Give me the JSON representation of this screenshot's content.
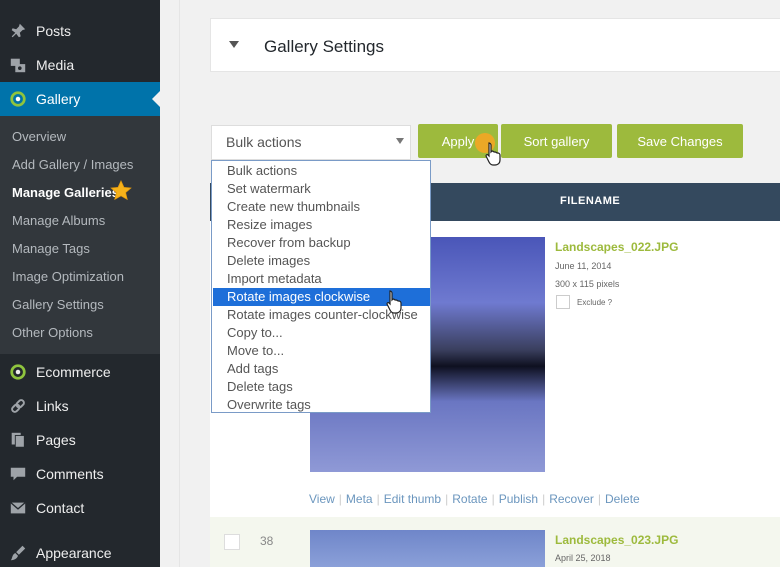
{
  "sidebar": {
    "items": [
      {
        "label": "Posts",
        "icon": "pushpin-icon"
      },
      {
        "label": "Media",
        "icon": "media-icon"
      },
      {
        "label": "Gallery",
        "icon": "gallery-icon"
      },
      {
        "label": "Ecommerce",
        "icon": "ecommerce-icon"
      },
      {
        "label": "Links",
        "icon": "link-icon"
      },
      {
        "label": "Pages",
        "icon": "pages-icon"
      },
      {
        "label": "Comments",
        "icon": "comment-icon"
      },
      {
        "label": "Contact",
        "icon": "mail-icon"
      },
      {
        "label": "Appearance",
        "icon": "brush-icon"
      }
    ],
    "submenu": [
      "Overview",
      "Add Gallery / Images",
      "Manage Galleries",
      "Manage Albums",
      "Manage Tags",
      "Image Optimization",
      "Gallery Settings",
      "Other Options"
    ],
    "active_color": "#0073aa"
  },
  "settings_box": {
    "title": "Gallery Settings"
  },
  "toolbar": {
    "bulk_value": "Bulk actions",
    "apply_label": "Apply",
    "sort_label": "Sort gallery",
    "save_label": "Save Changes",
    "button_color": "#9dba3d"
  },
  "dropdown": {
    "options": [
      "Bulk actions",
      "Set watermark",
      "Create new thumbnails",
      "Resize images",
      "Recover from backup",
      "Delete images",
      "Import metadata",
      "Rotate images clockwise",
      "Rotate images counter-clockwise",
      "Copy to...",
      "Move to...",
      "Add tags",
      "Delete tags",
      "Overwrite tags"
    ],
    "selected": "Rotate images clockwise"
  },
  "table": {
    "header_filename": "FILENAME",
    "rows": [
      {
        "filename": "Landscapes_022.JPG",
        "date": "June 11, 2014",
        "dims": "300 x 115 pixels",
        "exclude_label": "Exclude ?",
        "actions": [
          "View",
          "Meta",
          "Edit thumb",
          "Rotate",
          "Publish",
          "Recover",
          "Delete"
        ]
      },
      {
        "id": "38",
        "filename": "Landscapes_023.JPG",
        "date": "April 25, 2018"
      }
    ]
  }
}
